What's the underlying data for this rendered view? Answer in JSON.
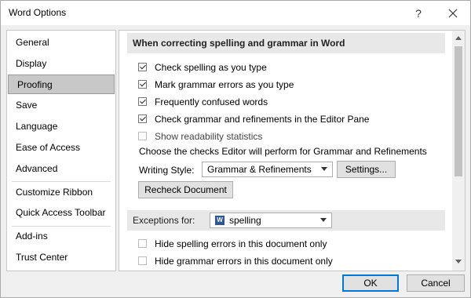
{
  "window": {
    "title": "Word Options",
    "help_glyph": "?",
    "close_glyph": "×"
  },
  "sidebar": {
    "items": [
      {
        "label": "General"
      },
      {
        "label": "Display"
      },
      {
        "label": "Proofing",
        "selected": true
      },
      {
        "label": "Save"
      },
      {
        "label": "Language"
      },
      {
        "label": "Ease of Access"
      },
      {
        "label": "Advanced"
      },
      {
        "label": "Customize Ribbon"
      },
      {
        "label": "Quick Access Toolbar"
      },
      {
        "label": "Add-ins"
      },
      {
        "label": "Trust Center"
      }
    ]
  },
  "content": {
    "section_title": "When correcting spelling and grammar in Word",
    "options": [
      {
        "label": "Check spelling as you type",
        "checked": true
      },
      {
        "label": "Mark grammar errors as you type",
        "checked": true
      },
      {
        "label": "Frequently confused words",
        "checked": true
      },
      {
        "label": "Check grammar and refinements in the Editor Pane",
        "checked": true
      },
      {
        "label": "Show readability statistics",
        "checked": false
      }
    ],
    "choose_text": "Choose the checks Editor will perform for Grammar and Refinements",
    "writing_style_label": "Writing Style:",
    "writing_style_value": "Grammar & Refinements",
    "settings_button": "Settings...",
    "recheck_button": "Recheck Document",
    "exceptions_label": "Exceptions for:",
    "exceptions_value": "spelling",
    "exceptions_icon_letter": "W",
    "exception_options": [
      {
        "label": "Hide spelling errors in this document only",
        "checked": false
      },
      {
        "label": "Hide grammar errors in this document only",
        "checked": false
      }
    ]
  },
  "footer": {
    "ok_button": "OK",
    "cancel_button": "Cancel"
  },
  "colors": {
    "selected_bg": "#c8c8c8",
    "accent": "#0078d7",
    "section_bg": "#e8e8e8"
  }
}
